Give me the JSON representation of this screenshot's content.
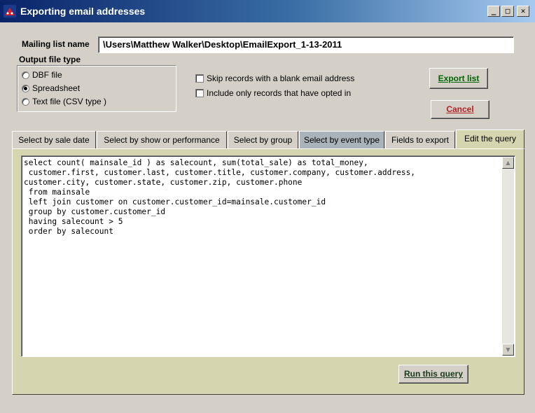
{
  "window": {
    "title": "Exporting email addresses",
    "min_label": "_",
    "max_label": "□",
    "close_label": "✕"
  },
  "mailing": {
    "label": "Mailing list name",
    "value": "\\Users\\Matthew Walker\\Desktop\\EmailExport_1-13-2011"
  },
  "output": {
    "label": "Output file type",
    "options": [
      {
        "label": "DBF file",
        "checked": false
      },
      {
        "label": "Spreadsheet",
        "checked": true
      },
      {
        "label": "Text file (CSV type )",
        "checked": false
      }
    ]
  },
  "options": {
    "skip_blank": "Skip records with a blank email address",
    "opted_in": "Include only records that have opted in"
  },
  "buttons": {
    "export": "Export list",
    "cancel": "Cancel",
    "run": "Run this query"
  },
  "tabs": [
    "Select by sale date",
    "Select by show or performance",
    "Select by group",
    "Select by event type",
    "Fields to export",
    "Edit the query"
  ],
  "active_tab": 5,
  "query": "select count( mainsale_id ) as salecount, sum(total_sale) as total_money,\n customer.first, customer.last, customer.title, customer.company, customer.address,\ncustomer.city, customer.state, customer.zip, customer.phone\n from mainsale\n left join customer on customer.customer_id=mainsale.customer_id\n group by customer.customer_id\n having salecount > 5\n order by salecount",
  "colors": {
    "panel": "#d5d5b0",
    "event_tab": "#a9b3b9",
    "title_start": "#0a246a",
    "title_end": "#a6caf0"
  }
}
